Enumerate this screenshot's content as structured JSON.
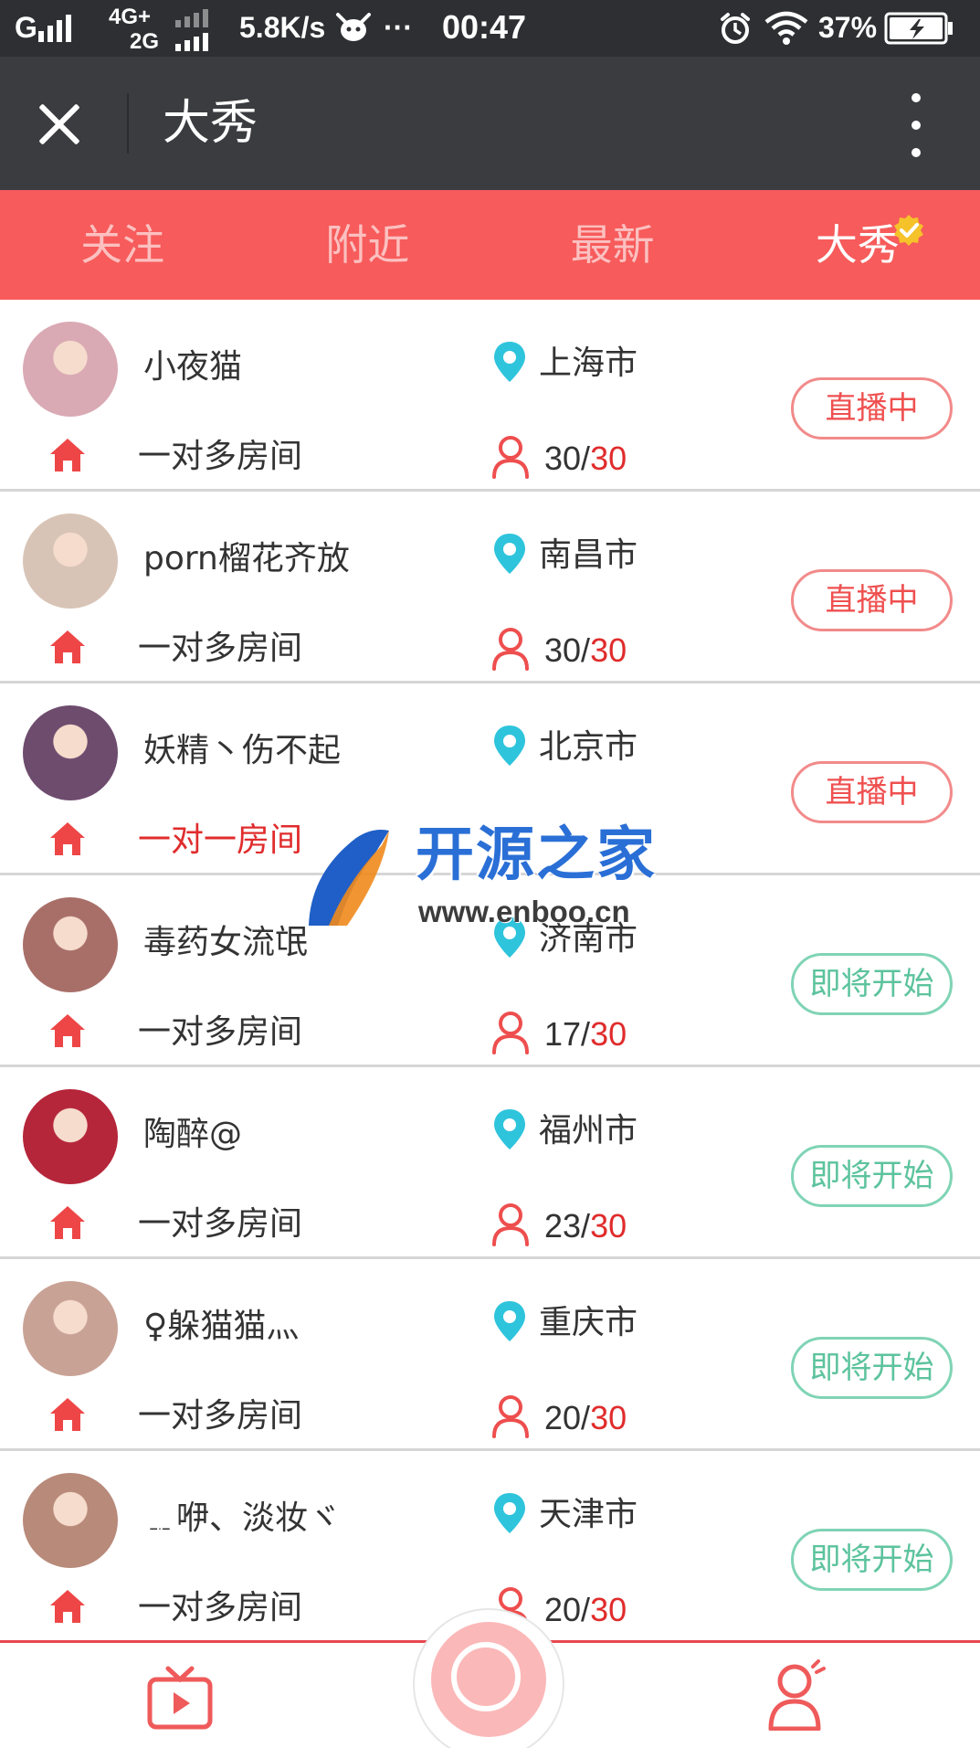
{
  "status_bar": {
    "carrier": "G",
    "network_top": "4G+",
    "network_bottom": "2G",
    "speed": "5.8K/s",
    "dots": "···",
    "time": "00:47",
    "battery": "37%"
  },
  "title_bar": {
    "title": "大秀"
  },
  "tabs": [
    {
      "label": "关注",
      "active": false
    },
    {
      "label": "附近",
      "active": false
    },
    {
      "label": "最新",
      "active": false
    },
    {
      "label": "大秀",
      "active": true
    }
  ],
  "rooms": [
    {
      "name": "小夜猫",
      "room": "一对多房间",
      "city": "上海市",
      "current": "30",
      "max": "30",
      "status": "直播中",
      "state": "live",
      "avatar_color": "#d9a9b4"
    },
    {
      "name": "porn榴花齐放",
      "room": "一对多房间",
      "city": "南昌市",
      "current": "30",
      "max": "30",
      "status": "直播中",
      "state": "live",
      "avatar_color": "#d8c4b6"
    },
    {
      "name": "妖精丶伤不起",
      "room": "一对一房间",
      "city": "北京市",
      "current": "",
      "max": "",
      "status": "直播中",
      "state": "live",
      "avatar_color": "#6e4c6e"
    },
    {
      "name": "毒药女流氓",
      "room": "一对多房间",
      "city": "济南市",
      "current": "17",
      "max": "30",
      "status": "即将开始",
      "state": "soon",
      "avatar_color": "#a86f68"
    },
    {
      "name": "陶醉@",
      "room": "一对多房间",
      "city": "福州市",
      "current": "23",
      "max": "30",
      "status": "即将开始",
      "state": "soon",
      "avatar_color": "#b5263a"
    },
    {
      "name": "♀躲猫猫灬",
      "room": "一对多房间",
      "city": "重庆市",
      "current": "20",
      "max": "30",
      "status": "即将开始",
      "state": "soon",
      "avatar_color": "#c9a296"
    },
    {
      "name": "﹎咿、淡妆ヾ",
      "room": "一对多房间",
      "city": "天津市",
      "current": "20",
      "max": "30",
      "status": "即将开始",
      "state": "soon",
      "avatar_color": "#b88a7a"
    }
  ],
  "watermark": {
    "brand": "开源之家",
    "url": "www.enboo.cn"
  },
  "colors": {
    "tab_bar": "#f75b5b",
    "accent_red": "#e02c2c",
    "live_border": "#f28a8a",
    "soon_border": "#7fd4b5",
    "pin": "#2ec4dc"
  }
}
